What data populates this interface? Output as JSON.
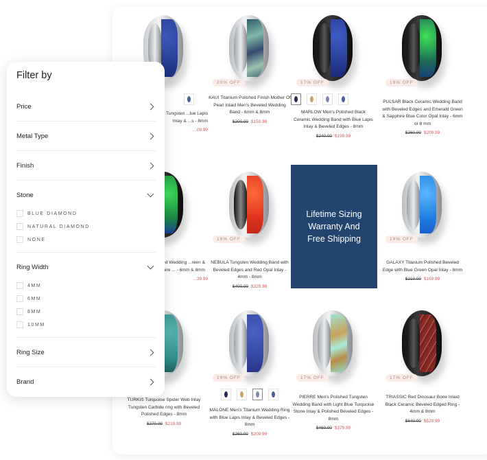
{
  "filter": {
    "title": "Filter by",
    "sections": [
      {
        "label": "Price",
        "state": "collapsed"
      },
      {
        "label": "Metal Type",
        "state": "collapsed"
      },
      {
        "label": "Finish",
        "state": "collapsed"
      },
      {
        "label": "Stone",
        "state": "expanded",
        "options": [
          "BLUE DIAMOND",
          "NATURAL DIAMOND",
          "NONE"
        ]
      },
      {
        "label": "Ring Width",
        "state": "expanded",
        "options": [
          "4MM",
          "6MM",
          "8MM",
          "10MM"
        ]
      },
      {
        "label": "Ring Size",
        "state": "collapsed"
      },
      {
        "label": "Brand",
        "state": "collapsed"
      }
    ]
  },
  "promo": {
    "text_line1": "Lifetime Sizing",
    "text_line2": "Warranty And",
    "text_line3": "Free Shipping",
    "background": "#23446e"
  },
  "colors": {
    "sale_price": "#d0575a",
    "badge_bg": "#fbece8"
  },
  "products": [
    {
      "name": "...ned Tungsten ...lue Lapis Inlay & ...s - 8mm",
      "old_price": "",
      "price": "...09.99",
      "badge": "",
      "inlay": "lapis"
    },
    {
      "name": "KAUI Titanium Polished Finish Mother Of Pearl Inlaid Men's Beveled Wedding Band - 6mm & 8mm",
      "old_price": "$200.00",
      "price": "$159.99",
      "badge": "20% OFF",
      "inlay": "pearl"
    },
    {
      "name": "MARLOW Men's Polished Black Ceramic Wedding Band with Blue Lapis Inlay & Beveled Edges - 8mm",
      "old_price": "$240.00",
      "price": "$199.99",
      "badge": "17% OFF",
      "inlay": "lapis"
    },
    {
      "name": "PULSAR Black Ceramic Wedding Band with Beveled Edges and Emerald Green & Sapphire Blue Color Opal Inlay - 6mm or 8 mm",
      "old_price": "$260.00",
      "price": "$209.99",
      "badge": "19% OFF",
      "inlay": "green-opal"
    },
    {
      "name": "...veled Wedding ...reen & Sapphire ... - 6mm & 8mm",
      "old_price": "",
      "price": "...39.99",
      "badge": "",
      "inlay": "green-opal"
    },
    {
      "name": "NEBULA Tungsten Wedding Band with Beveled Edges and Red Opal Inlay - 4mm - 8mm",
      "old_price": "$400.00",
      "price": "$329.99",
      "badge": "18% OFF",
      "inlay": "red-opal"
    },
    {
      "name": "GALAXY Titanium Polished Beveled Edge with Blue Green Opal Inlay - 8mm",
      "old_price": "$210.00",
      "price": "$169.99",
      "badge": "19% OFF",
      "inlay": "blue-opal"
    },
    {
      "name": "TURKIS Turquoise Spider Web Inlay Tungsten Carbide ring with Beveled Polished Edges - 8mm",
      "old_price": "$270.00",
      "price": "$219.99",
      "badge": "",
      "inlay": "turquoise"
    },
    {
      "name": "MALONE Men's Titanium Wedding Ring with Blue Lapis Inlay & Beveled Edges - 8mm",
      "old_price": "$260.00",
      "price": "$209.99",
      "badge": "19% OFF",
      "inlay": "lapis"
    },
    {
      "name": "PIERRE Men's Polished Tungsten Wedding Band with Light Blue Turquoise Stone Inlay & Polished Beveled Edges - 8mm",
      "old_price": "$460.00",
      "price": "$379.99",
      "badge": "17% OFF",
      "inlay": "light-turquoise"
    },
    {
      "name": "TRIASSIC Red Dinosaur Bone Inlaid Black Ceramic Beveled Edged Ring - 4mm & 8mm",
      "old_price": "$640.00",
      "price": "$529.99",
      "badge": "17% OFF",
      "inlay": "dino-bone"
    }
  ],
  "swatch_sets": {
    "marlow": [
      "black-blue",
      "gold",
      "silver-blue",
      "blue"
    ],
    "malone": [
      "black-blue",
      "gold",
      "silver-blue",
      "blue"
    ],
    "first": [
      "silver-blue"
    ]
  }
}
